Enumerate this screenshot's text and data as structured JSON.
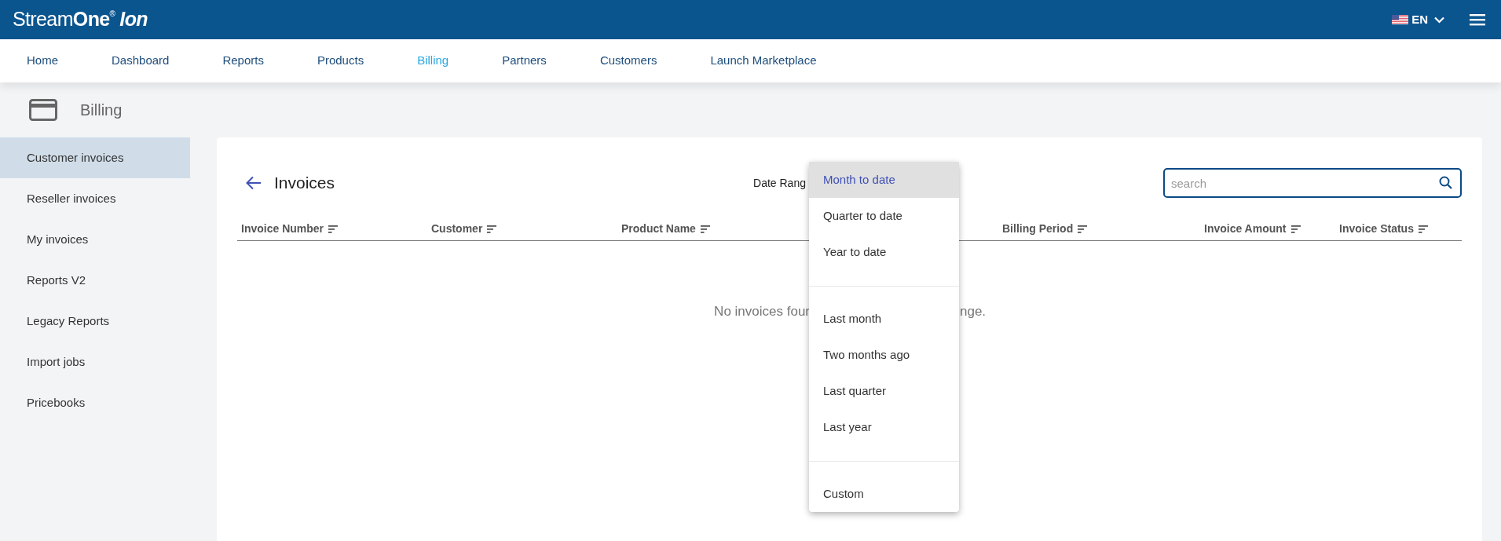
{
  "header": {
    "logo": {
      "light": "Stream",
      "bold": "One",
      "mark": "®",
      "product": "Ion"
    },
    "language": "EN"
  },
  "nav": [
    {
      "label": "Home",
      "selected": false
    },
    {
      "label": "Dashboard",
      "selected": false
    },
    {
      "label": "Reports",
      "selected": false
    },
    {
      "label": "Products",
      "selected": false
    },
    {
      "label": "Billing",
      "selected": true
    },
    {
      "label": "Partners",
      "selected": false
    },
    {
      "label": "Customers",
      "selected": false
    },
    {
      "label": "Launch Marketplace",
      "selected": false
    }
  ],
  "page_title": "Billing",
  "sidebar": [
    {
      "label": "Customer invoices",
      "selected": true
    },
    {
      "label": "Reseller invoices",
      "selected": false
    },
    {
      "label": "My invoices",
      "selected": false
    },
    {
      "label": "Reports V2",
      "selected": false
    },
    {
      "label": "Legacy Reports",
      "selected": false
    },
    {
      "label": "Import jobs",
      "selected": false
    },
    {
      "label": "Pricebooks",
      "selected": false
    }
  ],
  "card": {
    "title": "Invoices",
    "date_range_label": "Date Rang",
    "search": {
      "placeholder": "search"
    },
    "columns": [
      {
        "label": "Invoice Number"
      },
      {
        "label": "Customer"
      },
      {
        "label": "Product Name"
      },
      {
        "label": "Billing Period"
      },
      {
        "label": "Invoice Amount"
      },
      {
        "label": "Invoice Status"
      }
    ],
    "empty_message": {
      "before": "No invoices four",
      "after": "nge."
    }
  },
  "date_range_menu": {
    "groups": [
      [
        {
          "label": "Month to date",
          "selected": true
        },
        {
          "label": "Quarter to date",
          "selected": false
        },
        {
          "label": "Year to date",
          "selected": false
        }
      ],
      [
        {
          "label": "Last month",
          "selected": false
        },
        {
          "label": "Two months ago",
          "selected": false
        },
        {
          "label": "Last quarter",
          "selected": false
        },
        {
          "label": "Last year",
          "selected": false
        }
      ],
      [
        {
          "label": "Custom",
          "selected": false
        }
      ]
    ]
  }
}
